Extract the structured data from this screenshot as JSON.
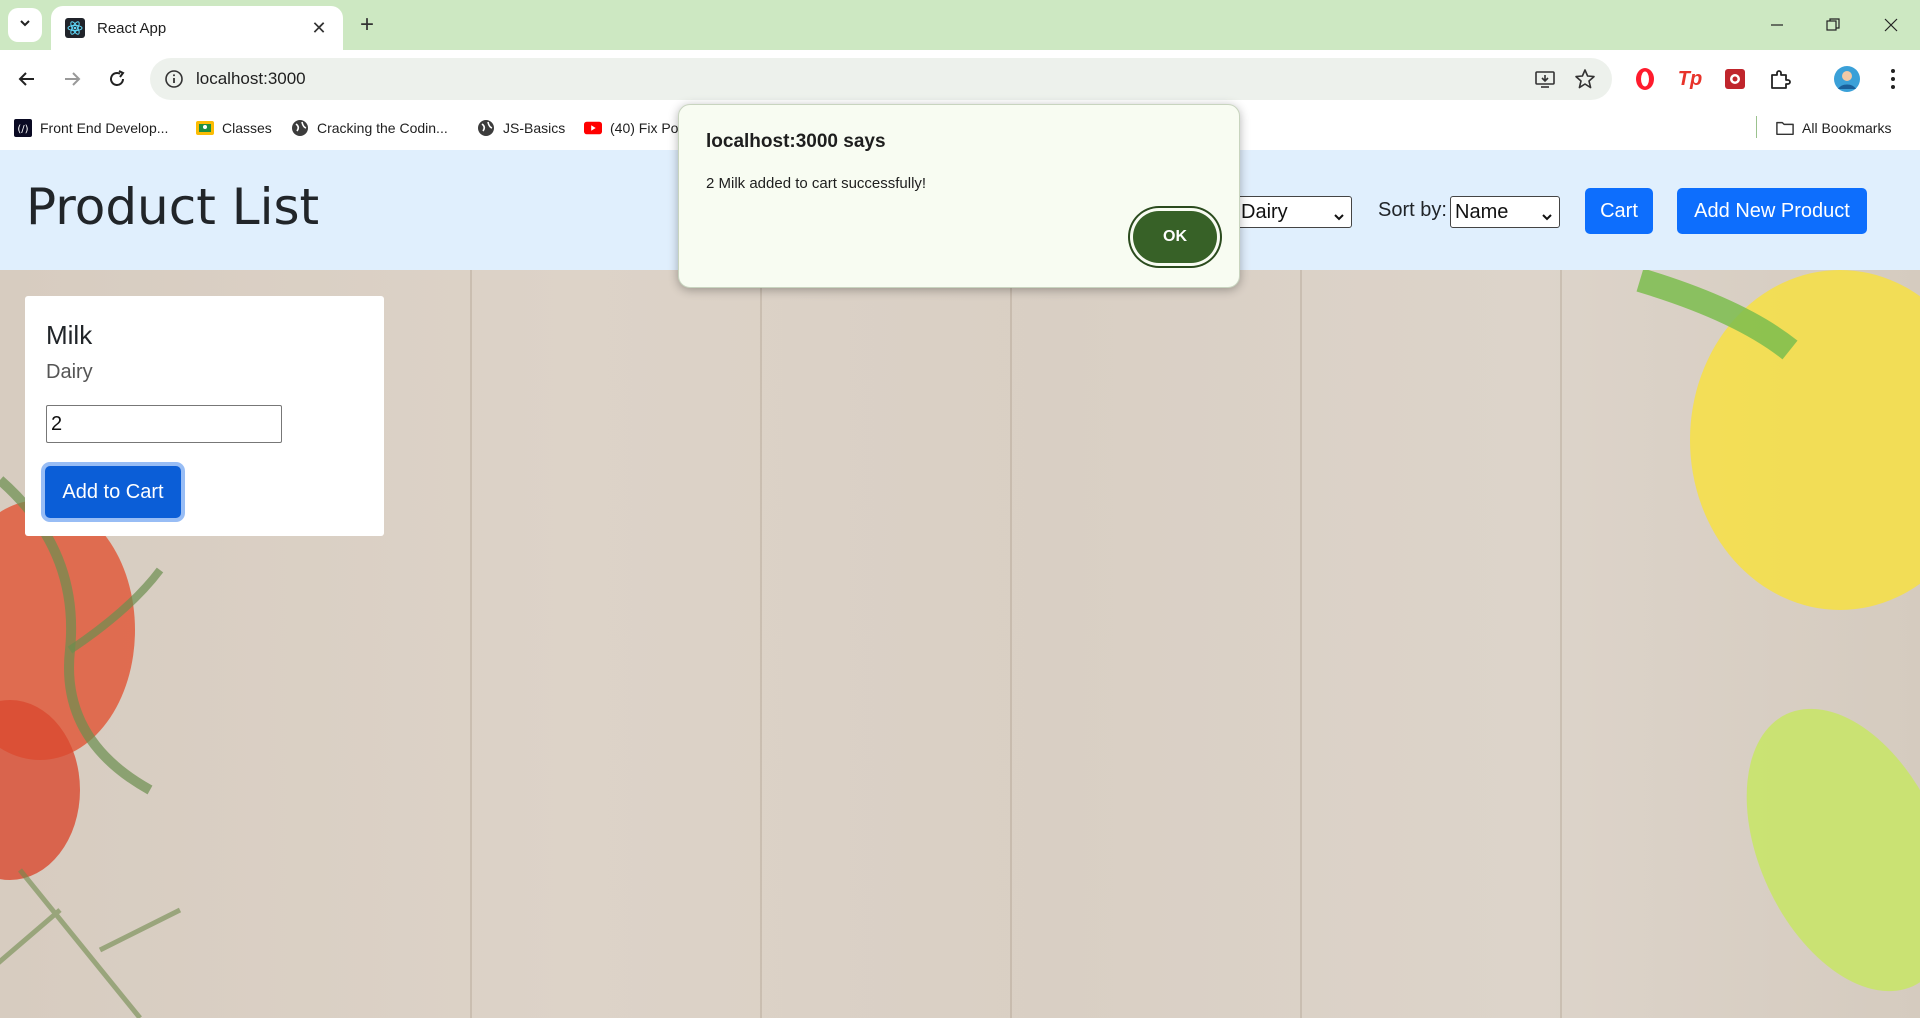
{
  "browser": {
    "tab_title": "React App",
    "url": "localhost:3000",
    "bookmarks": [
      {
        "label": "Front End Develop...",
        "icon": "freecodecamp-icon"
      },
      {
        "label": "Classes",
        "icon": "classroom-icon"
      },
      {
        "label": "Cracking the Codin...",
        "icon": "globe-icon"
      },
      {
        "label": "JS-Basics",
        "icon": "globe-icon"
      },
      {
        "label": "(40) Fix Po",
        "icon": "youtube-icon"
      }
    ],
    "all_bookmarks_label": "All Bookmarks"
  },
  "header": {
    "title": "Product List",
    "filter_value": "Dairy",
    "sort_label": "Sort by:",
    "sort_value": "Name",
    "cart_label": "Cart",
    "add_product_label": "Add New Product"
  },
  "products": [
    {
      "name": "Milk",
      "category": "Dairy",
      "quantity": "2",
      "add_label": "Add to Cart"
    }
  ],
  "dialog": {
    "title": "localhost:3000 says",
    "message": "2 Milk added to cart successfully!",
    "ok_label": "OK"
  },
  "colors": {
    "tabstrip": "#cde8c2",
    "header_bg": "#e0effd",
    "primary": "#0d6efd",
    "dialog_ok": "#376127"
  }
}
